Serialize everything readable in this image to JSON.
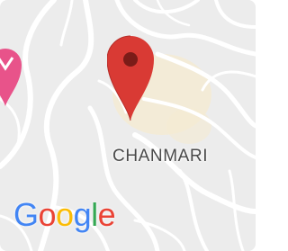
{
  "map": {
    "place_label": "CHANMARI",
    "logo": {
      "letters": [
        "G",
        "o",
        "o",
        "g",
        "l",
        "e"
      ]
    },
    "colors": {
      "pin": "#d93a34",
      "pin_center": "#7b1c18",
      "poi": "#e8538a",
      "road": "#ffffff",
      "land": "#ececec",
      "highlight": "#f5ebd2",
      "logo": [
        "#4285F4",
        "#EA4335",
        "#FBBC05",
        "#4285F4",
        "#34A853",
        "#EA4335"
      ]
    },
    "icons": [
      "location-pin-icon",
      "place-marker-icon"
    ]
  }
}
